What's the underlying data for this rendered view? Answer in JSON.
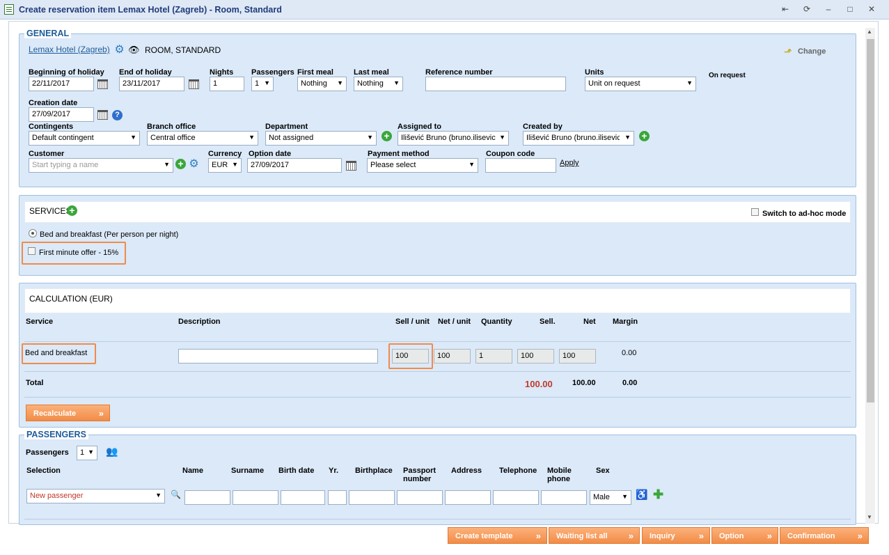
{
  "window": {
    "title": "Create reservation item Lemax Hotel (Zagreb) - Room, Standard"
  },
  "general": {
    "legend": "GENERAL",
    "hotel_link": "Lemax Hotel (Zagreb)",
    "room_type": "ROOM, STANDARD",
    "change_label": "Change",
    "beginning_label": "Beginning of holiday",
    "beginning_value": "22/11/2017",
    "end_label": "End of holiday",
    "end_value": "23/11/2017",
    "nights_label": "Nights",
    "nights_value": "1",
    "passengers_label": "Passengers",
    "passengers_value": "1",
    "first_meal_label": "First meal",
    "first_meal_value": "Nothing",
    "last_meal_label": "Last meal",
    "last_meal_value": "Nothing",
    "reference_label": "Reference number",
    "reference_value": "",
    "units_label": "Units",
    "units_value": "Unit on request",
    "on_request": "On request",
    "creation_label": "Creation date",
    "creation_value": "27/09/2017",
    "contingents_label": "Contingents",
    "contingents_value": "Default contingent",
    "branch_label": "Branch office",
    "branch_value": "Central office",
    "department_label": "Department",
    "department_value": "Not assigned",
    "assigned_label": "Assigned to",
    "assigned_value": "Ilišević Bruno (bruno.ilisevic",
    "created_by_label": "Created by",
    "created_by_value": "Ilišević Bruno (bruno.ilisevic",
    "customer_label": "Customer",
    "customer_placeholder": "Start typing a name",
    "currency_label": "Currency",
    "currency_value": "EUR",
    "option_label": "Option date",
    "option_value": "27/09/2017",
    "payment_label": "Payment method",
    "payment_value": "Please select",
    "coupon_label": "Coupon code",
    "coupon_value": "",
    "apply_label": "Apply"
  },
  "services": {
    "title": "SERVICES",
    "adhoc_label": "Switch to ad-hoc mode",
    "option1": "Bed and breakfast (Per person per night)",
    "option2": "First minute offer - 15%"
  },
  "calculation": {
    "title": "CALCULATION (EUR)",
    "headers": {
      "service": "Service",
      "description": "Description",
      "sell_unit": "Sell / unit",
      "net_unit": "Net / unit",
      "quantity": "Quantity",
      "sell": "Sell.",
      "net": "Net",
      "margin": "Margin"
    },
    "row": {
      "service": "Bed and breakfast",
      "description": "",
      "sell_unit": "100",
      "net_unit": "100",
      "quantity": "1",
      "sell": "100",
      "net": "100",
      "margin": "0.00"
    },
    "total_label": "Total",
    "total_sell": "100.00",
    "total_net": "100.00",
    "total_margin": "0.00",
    "recalculate_label": "Recalculate"
  },
  "passengers": {
    "legend": "PASSENGERS",
    "count_label": "Passengers",
    "count_value": "1",
    "headers": {
      "selection": "Selection",
      "name": "Name",
      "surname": "Surname",
      "birth_date": "Birth date",
      "yr": "Yr.",
      "birthplace": "Birthplace",
      "passport": "Passport number",
      "address": "Address",
      "telephone": "Telephone",
      "mobile": "Mobile phone",
      "sex": "Sex"
    },
    "selection_value": "New passenger",
    "sex_value": "Male"
  },
  "footer": {
    "create_template": "Create template",
    "waiting_list": "Waiting list all",
    "inquiry": "Inquiry",
    "option": "Option",
    "confirmation": "Confirmation"
  },
  "colors": {
    "accent_orange": "#f28c47",
    "total_red": "#c0392b",
    "section_bg": "#dbe9f8",
    "title_blue": "#1f3c7a"
  },
  "icons": {
    "window": "document-icon",
    "gear": "gear-icon",
    "eye": "eye-icon",
    "change": "change-arrow-icon",
    "add": "plus-icon",
    "calendar": "calendar-icon",
    "help": "help-icon",
    "search": "magnifier-icon",
    "people": "people-icon",
    "person": "person-icon"
  }
}
